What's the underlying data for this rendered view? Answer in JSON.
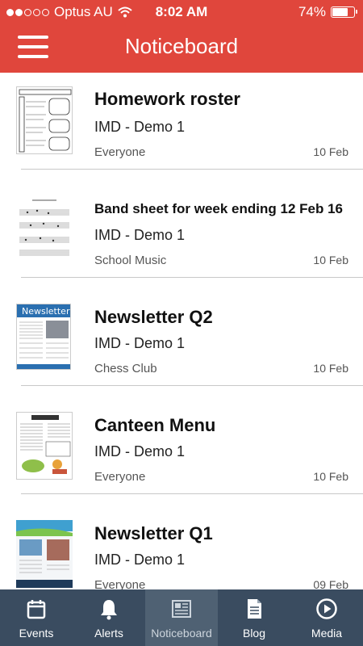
{
  "status_bar": {
    "carrier": "Optus AU",
    "time": "8:02 AM",
    "battery": "74%",
    "battery_level": 0.74
  },
  "header": {
    "title": "Noticeboard"
  },
  "notices": [
    {
      "title": "Homework roster",
      "subtitle": "IMD - Demo 1",
      "group": "Everyone",
      "date": "10 Feb",
      "thumb": "thumbnail-homework"
    },
    {
      "title": "Band sheet for week ending 12 Feb 16",
      "subtitle": "IMD - Demo 1",
      "group": "School Music",
      "date": "10 Feb",
      "thumb": "thumbnail-sheet-music"
    },
    {
      "title": "Newsletter Q2",
      "subtitle": "IMD - Demo 1",
      "group": "Chess Club",
      "date": "10 Feb",
      "thumb": "thumbnail-newsletter",
      "thumb_text": "Newsletter"
    },
    {
      "title": "Canteen Menu",
      "subtitle": "IMD - Demo 1",
      "group": "Everyone",
      "date": "10 Feb",
      "thumb": "thumbnail-canteen-menu"
    },
    {
      "title": "Newsletter Q1",
      "subtitle": "IMD - Demo 1",
      "group": "Everyone",
      "date": "09 Feb",
      "thumb": "thumbnail-newsletter-q1"
    }
  ],
  "tabs": [
    {
      "label": "Events",
      "icon": "calendar-icon",
      "active": false
    },
    {
      "label": "Alerts",
      "icon": "bell-icon",
      "active": false
    },
    {
      "label": "Noticeboard",
      "icon": "newspaper-icon",
      "active": true
    },
    {
      "label": "Blog",
      "icon": "document-icon",
      "active": false
    },
    {
      "label": "Media",
      "icon": "play-icon",
      "active": false
    }
  ],
  "colors": {
    "header": "#e0463c",
    "tabbar": "#3a4c60",
    "tab_active": "#4f6173"
  }
}
